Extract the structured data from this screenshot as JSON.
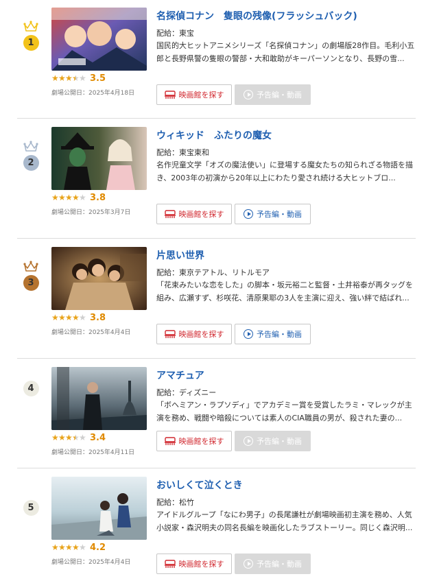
{
  "movies": [
    {
      "rank": "1",
      "badge_color": "#f2c21a",
      "rank_text_color": "#333333",
      "crown_color": "#f2c21a",
      "title": "名探偵コナン　隻眼の残像(フラッシュバック)",
      "distributor": "配給：東宝",
      "synopsis": "国民的大ヒットアニメシリーズ「名探偵コナン」の劇場版28作目。毛利小五郎と長野県警の隻眼の警部・大和敢助がキーパーソンとなり、長野の雪...",
      "rating": "3.5",
      "release": "劇場公開日：2025年4月18日",
      "trailer_enabled": false
    },
    {
      "rank": "2",
      "badge_color": "#a8b8cc",
      "rank_text_color": "#333333",
      "crown_color": "#a8b8cc",
      "title": "ウィキッド　ふたりの魔女",
      "distributor": "配給：東宝東和",
      "synopsis": "名作児童文学「オズの魔法使い」に登場する魔女たちの知られざる物語を描き、2003年の初演から20年以上にわたり愛され続ける大ヒットブロ...",
      "rating": "3.8",
      "release": "劇場公開日：2025年3月7日",
      "trailer_enabled": true
    },
    {
      "rank": "3",
      "badge_color": "#b5732f",
      "rank_text_color": "#333333",
      "crown_color": "#b5732f",
      "title": "片思い世界",
      "distributor": "配給：東京テアトル、リトルモア",
      "synopsis": "「花束みたいな恋をした」の脚本・坂元裕二と監督・土井裕泰が再タッグを組み、広瀬すず、杉咲花、清原果耶の3人を主演に迎え、強い絆で結ばれ...",
      "rating": "3.8",
      "release": "劇場公開日：2025年4月4日",
      "trailer_enabled": true
    },
    {
      "rank": "4",
      "badge_color": "#ecebe1",
      "rank_text_color": "#333333",
      "crown_color": "",
      "title": "アマチュア",
      "distributor": "配給：ディズニー",
      "synopsis": "「ボヘミアン・ラプソディ」でアカデミー賞を受賞したラミ・マレックが主演を務め、戦闘や暗殺については素人のCIA職員の男が、殺された妻の...",
      "rating": "3.4",
      "release": "劇場公開日：2025年4月11日",
      "trailer_enabled": false
    },
    {
      "rank": "5",
      "badge_color": "#ecebe1",
      "rank_text_color": "#333333",
      "crown_color": "",
      "title": "おいしくて泣くとき",
      "distributor": "配給：松竹",
      "synopsis": "アイドルグループ「なにわ男子」の長尾謙杜が劇場映画初主演を務め、人気小説家・森沢明夫の同名長編を映画化したラブストーリー。同じく森沢明...",
      "rating": "4.2",
      "release": "劇場公開日：2025年4月4日",
      "trailer_enabled": false
    }
  ],
  "buttons": {
    "theater_label": "映画館を探す",
    "trailer_label": "予告編・動画"
  },
  "icons": {
    "crown": "crown-icon",
    "theater": "theater-seat-icon",
    "play": "play-circle-icon",
    "star": "star-icon"
  }
}
